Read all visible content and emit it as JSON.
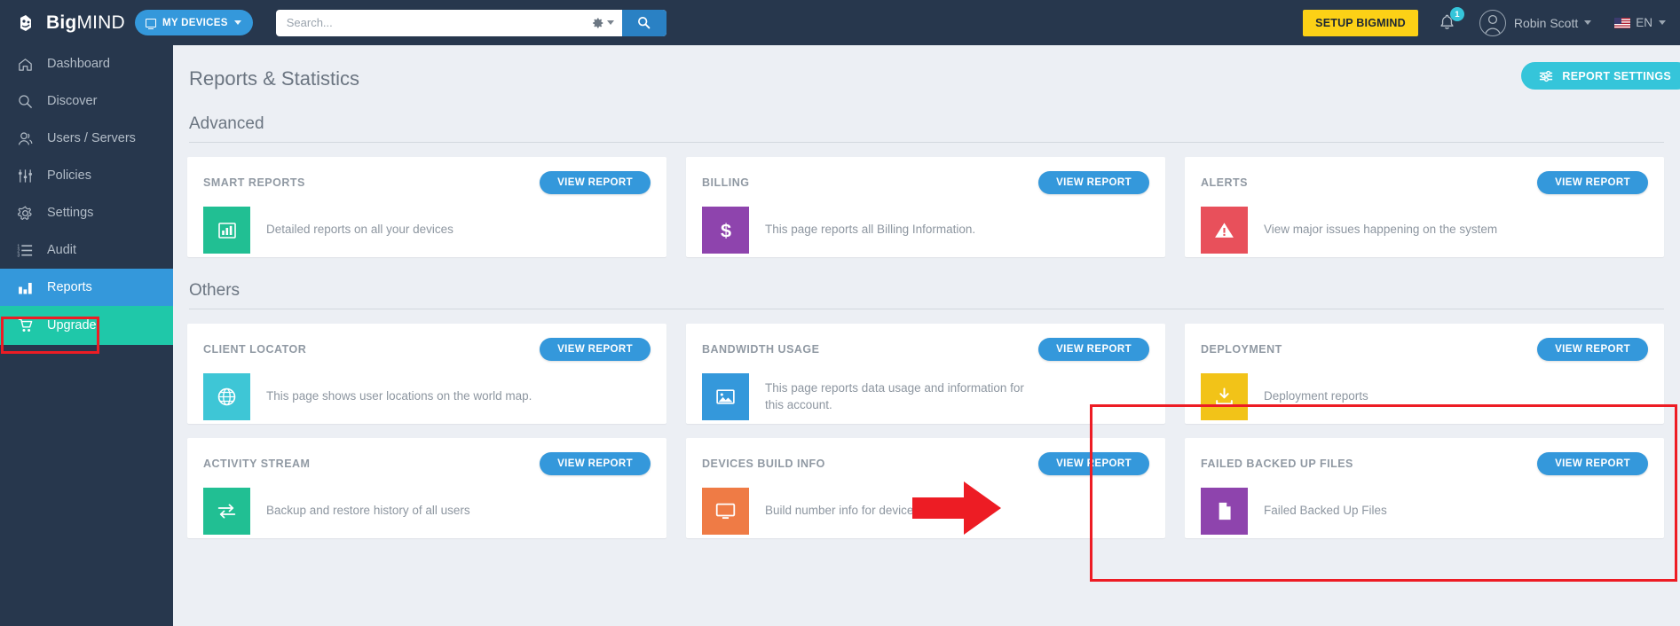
{
  "header": {
    "logo_big": "Big",
    "logo_mind": "MIND",
    "logo_icon": "bigmind-logo-icon",
    "my_devices_label": "MY DEVICES",
    "my_devices_icon": "monitor-icon",
    "search_placeholder": "Search...",
    "search_value": "",
    "search_gear_icon": "gear-icon",
    "search_button_icon": "search-icon",
    "setup_label": "SETUP BIGMIND",
    "bell_icon": "bell-icon",
    "bell_badge": "1",
    "avatar_icon": "user-avatar-icon",
    "user_name": "Robin Scott",
    "lang_flag_icon": "us-flag-icon",
    "lang_code": "EN",
    "accent_blue": "#3498db",
    "accent_yellow": "#fcd116",
    "navy": "#27374d"
  },
  "sidebar": {
    "items": [
      {
        "label": "Dashboard",
        "icon": "home-icon",
        "state": "normal"
      },
      {
        "label": "Discover",
        "icon": "search-icon",
        "state": "normal"
      },
      {
        "label": "Users / Servers",
        "icon": "users-icon",
        "state": "normal"
      },
      {
        "label": "Policies",
        "icon": "sliders-icon",
        "state": "normal"
      },
      {
        "label": "Settings",
        "icon": "gear-icon",
        "state": "normal"
      },
      {
        "label": "Audit",
        "icon": "list-ol-icon",
        "state": "normal"
      },
      {
        "label": "Reports",
        "icon": "bar-chart-icon",
        "state": "active"
      },
      {
        "label": "Upgrade",
        "icon": "cart-icon",
        "state": "upgrade"
      }
    ],
    "active_highlight_color": "#ed1c24"
  },
  "main": {
    "page_title": "Reports & Statistics",
    "report_settings_label": "REPORT SETTINGS",
    "report_settings_icon": "sliders-icon",
    "sections": [
      {
        "title": "Advanced",
        "cards": [
          {
            "title": "SMART REPORTS",
            "button": "VIEW REPORT",
            "desc": "Detailed reports on all your devices",
            "icon": "bar-chart-icon",
            "tile_color": "#21bf93"
          },
          {
            "title": "BILLING",
            "button": "VIEW REPORT",
            "desc": "This page reports all Billing Information.",
            "icon": "dollar-icon",
            "tile_color": "#8e44ad"
          },
          {
            "title": "ALERTS",
            "button": "VIEW REPORT",
            "desc": "View major issues happening on the system",
            "icon": "warning-triangle-icon",
            "tile_color": "#e8505b"
          }
        ]
      },
      {
        "title": "Others",
        "cards": [
          {
            "title": "CLIENT LOCATOR",
            "button": "VIEW REPORT",
            "desc": "This page shows user locations on the world map.",
            "icon": "globe-icon",
            "tile_color": "#3ec6d6"
          },
          {
            "title": "BANDWIDTH USAGE",
            "button": "VIEW REPORT",
            "desc": "This page reports data usage and information for this account.",
            "icon": "image-icon",
            "tile_color": "#3498db"
          },
          {
            "title": "DEPLOYMENT",
            "button": "VIEW REPORT",
            "desc": "Deployment reports",
            "icon": "download-icon",
            "tile_color": "#f2c318"
          },
          {
            "title": "ACTIVITY STREAM",
            "button": "VIEW REPORT",
            "desc": "Backup and restore history of all users",
            "icon": "exchange-icon",
            "tile_color": "#21bf93"
          },
          {
            "title": "DEVICES BUILD INFO",
            "button": "VIEW REPORT",
            "desc": "Build number info for devices",
            "icon": "desktop-icon",
            "tile_color": "#ef7b45"
          },
          {
            "title": "FAILED BACKED UP FILES",
            "button": "VIEW REPORT",
            "desc": "Failed Backed Up Files",
            "icon": "file-icon",
            "tile_color": "#8e44ad",
            "highlighted": true
          }
        ]
      }
    ]
  },
  "annotations": {
    "box_color": "#ed1c24",
    "arrow_color": "#ed1c24",
    "arrow_name": "red-pointer-arrow"
  }
}
